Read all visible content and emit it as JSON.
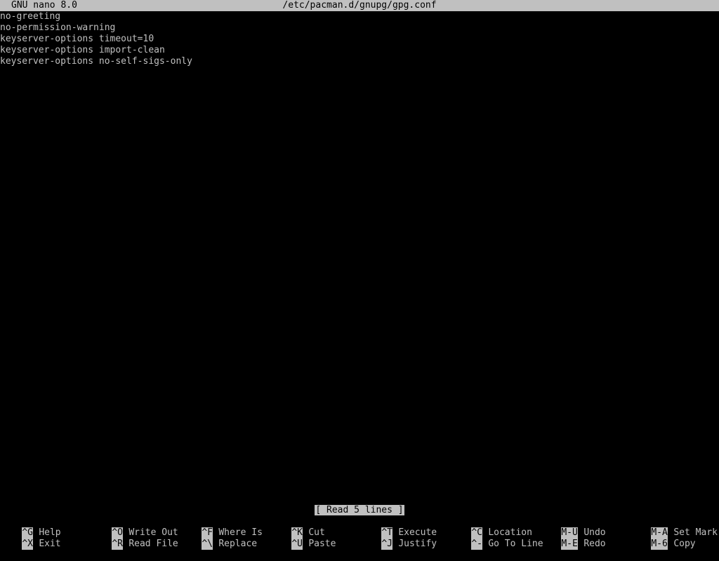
{
  "titlebar": {
    "app": "GNU nano 8.0",
    "filename": "/etc/pacman.d/gnupg/gpg.conf"
  },
  "editor": {
    "lines": [
      "no-greeting",
      "no-permission-warning",
      "keyserver-options timeout=10",
      "keyserver-options import-clean",
      "keyserver-options no-self-sigs-only"
    ]
  },
  "status": {
    "message": "[ Read 5 lines ]"
  },
  "shortcuts": {
    "row1": [
      {
        "key": "^G",
        "label": "Help"
      },
      {
        "key": "^O",
        "label": "Write Out"
      },
      {
        "key": "^F",
        "label": "Where Is"
      },
      {
        "key": "^K",
        "label": "Cut"
      },
      {
        "key": "^T",
        "label": "Execute"
      },
      {
        "key": "^C",
        "label": "Location"
      },
      {
        "key": "M-U",
        "label": "Undo"
      },
      {
        "key": "M-A",
        "label": "Set Mark"
      }
    ],
    "row2": [
      {
        "key": "^X",
        "label": "Exit"
      },
      {
        "key": "^R",
        "label": "Read File"
      },
      {
        "key": "^\\",
        "label": "Replace"
      },
      {
        "key": "^U",
        "label": "Paste"
      },
      {
        "key": "^J",
        "label": "Justify"
      },
      {
        "key": "^-",
        "label": "Go To Line"
      },
      {
        "key": "M-E",
        "label": "Redo"
      },
      {
        "key": "M-6",
        "label": "Copy"
      }
    ]
  },
  "colors": {
    "background": "#000000",
    "foreground": "#c0c0c0",
    "inverse_bg": "#c0c0c0",
    "inverse_fg": "#000000"
  }
}
